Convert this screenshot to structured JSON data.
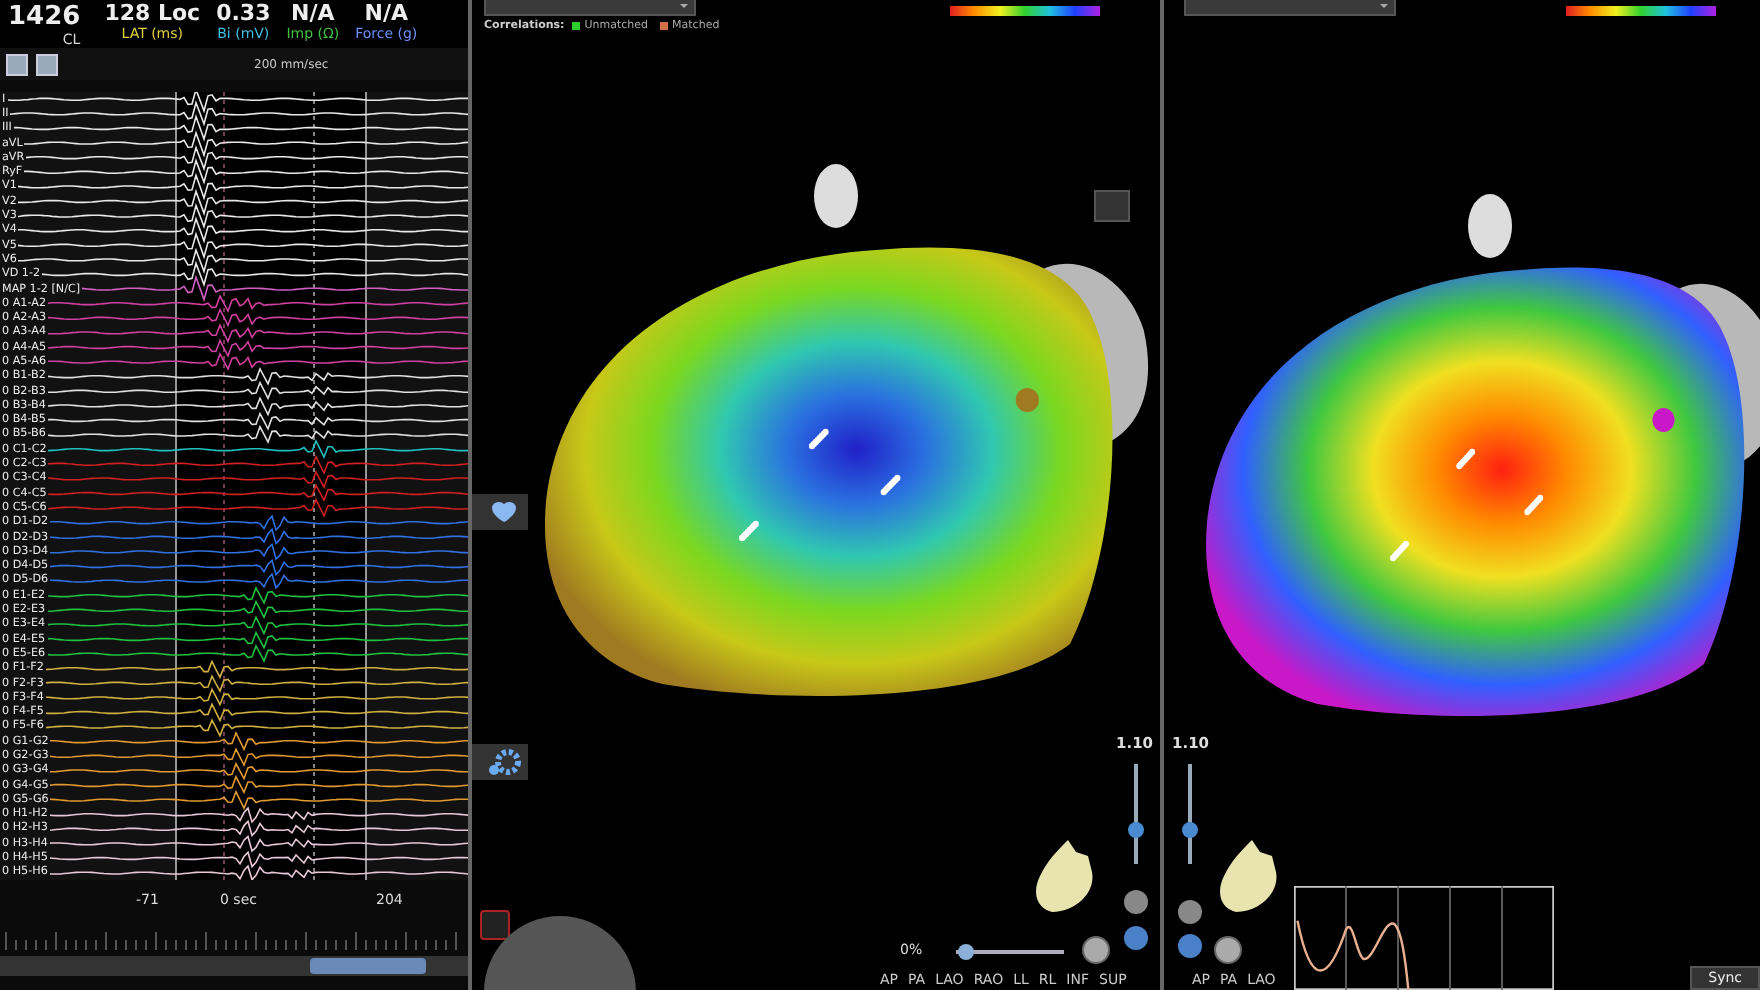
{
  "ecg_panel": {
    "readouts": [
      {
        "value": "1426",
        "label": "CL",
        "color": "#d8d8d8"
      },
      {
        "value": "128 Loc",
        "label": "LAT (ms)",
        "color": "#e0d040"
      },
      {
        "value": "0.33",
        "label": "Bi (mV)",
        "color": "#40c0e0"
      },
      {
        "value": "N/A",
        "label": "Imp (Ω)",
        "color": "#40c040"
      },
      {
        "value": "N/A",
        "label": "Force (g)",
        "color": "#7090ff"
      }
    ],
    "sweep_speed": "200 mm/sec",
    "channels": [
      {
        "label": "I",
        "color": "#e8e8e8"
      },
      {
        "label": "II",
        "color": "#e8e8e8"
      },
      {
        "label": "III",
        "color": "#e8e8e8"
      },
      {
        "label": "aVL",
        "color": "#e8e8e8"
      },
      {
        "label": "aVR",
        "color": "#e8e8e8"
      },
      {
        "label": "RyF",
        "color": "#e8e8e8"
      },
      {
        "label": "V1",
        "color": "#e8e8e8"
      },
      {
        "label": "V2",
        "color": "#e8e8e8"
      },
      {
        "label": "V3",
        "color": "#e8e8e8"
      },
      {
        "label": "V4",
        "color": "#e8e8e8"
      },
      {
        "label": "V5",
        "color": "#e8e8e8"
      },
      {
        "label": "V6",
        "color": "#e8e8e8"
      },
      {
        "label": "VD 1-2",
        "color": "#e8e8e8"
      },
      {
        "label": "MAP 1-2 [N/C]",
        "color": "#d060c0"
      },
      {
        "label": "0 A1-A2",
        "color": "#d040a0"
      },
      {
        "label": "0 A2-A3",
        "color": "#d040a0"
      },
      {
        "label": "0 A3-A4",
        "color": "#d040a0"
      },
      {
        "label": "0 A4-A5",
        "color": "#d040a0"
      },
      {
        "label": "0 A5-A6",
        "color": "#d040a0"
      },
      {
        "label": "0 B1-B2",
        "color": "#e0e0e0"
      },
      {
        "label": "0 B2-B3",
        "color": "#e0e0e0"
      },
      {
        "label": "0 B3-B4",
        "color": "#e0e0e0"
      },
      {
        "label": "0 B4-B5",
        "color": "#e0e0e0"
      },
      {
        "label": "0 B5-B6",
        "color": "#e0e0e0"
      },
      {
        "label": "0 C1-C2",
        "color": "#20c0c0"
      },
      {
        "label": "0 C2-C3",
        "color": "#d02020"
      },
      {
        "label": "0 C3-C4",
        "color": "#d02020"
      },
      {
        "label": "0 C4-C5",
        "color": "#d02020"
      },
      {
        "label": "0 C5-C6",
        "color": "#d02020"
      },
      {
        "label": "0 D1-D2",
        "color": "#3070e0"
      },
      {
        "label": "0 D2-D3",
        "color": "#3070e0"
      },
      {
        "label": "0 D3-D4",
        "color": "#3070e0"
      },
      {
        "label": "0 D4-D5",
        "color": "#3070e0"
      },
      {
        "label": "0 D5-D6",
        "color": "#3070e0"
      },
      {
        "label": "0 E1-E2",
        "color": "#20c040"
      },
      {
        "label": "0 E2-E3",
        "color": "#20c040"
      },
      {
        "label": "0 E3-E4",
        "color": "#20c040"
      },
      {
        "label": "0 E4-E5",
        "color": "#20c040"
      },
      {
        "label": "0 E5-E6",
        "color": "#20c040"
      },
      {
        "label": "0 F1-F2",
        "color": "#d0b040"
      },
      {
        "label": "0 F2-F3",
        "color": "#d0b040"
      },
      {
        "label": "0 F3-F4",
        "color": "#d0b040"
      },
      {
        "label": "0 F4-F5",
        "color": "#d0b040"
      },
      {
        "label": "0 F5-F6",
        "color": "#d0b040"
      },
      {
        "label": "0 G1-G2",
        "color": "#e09a30"
      },
      {
        "label": "0 G2-G3",
        "color": "#e09a30"
      },
      {
        "label": "0 G3-G4",
        "color": "#e09a30"
      },
      {
        "label": "0 G4-G5",
        "color": "#e09a30"
      },
      {
        "label": "0 G5-G6",
        "color": "#e09a30"
      },
      {
        "label": "0 H1-H2",
        "color": "#e8c8d8"
      },
      {
        "label": "0 H2-H3",
        "color": "#e8c8d8"
      },
      {
        "label": "0 H3-H4",
        "color": "#e8c8d8"
      },
      {
        "label": "0 H4-H5",
        "color": "#e8c8d8"
      },
      {
        "label": "0 H5-H6",
        "color": "#e8c8d8"
      }
    ],
    "axis_labels": [
      "-71",
      "0 sec",
      "204"
    ]
  },
  "map_panels": [
    {
      "kind": "cool",
      "correlations": {
        "label": "Correlations:",
        "items": [
          {
            "label": "Unmatched",
            "color": "#2ecc2e"
          },
          {
            "label": "Matched",
            "color": "#d07048"
          }
        ]
      },
      "zoom": {
        "reading": "1.10",
        "level": 0.35
      },
      "transparency": {
        "reading": "0%",
        "level": 0.1
      },
      "views": [
        "AP",
        "PA",
        "LAO",
        "RAO",
        "LL",
        "RL",
        "INF",
        "SUP"
      ]
    },
    {
      "kind": "warm",
      "zoom": {
        "reading": "1.10",
        "level": 0.35
      },
      "views": [
        "AP",
        "PA",
        "LAO"
      ]
    }
  ],
  "status_bar": {
    "sync": "Sync"
  }
}
